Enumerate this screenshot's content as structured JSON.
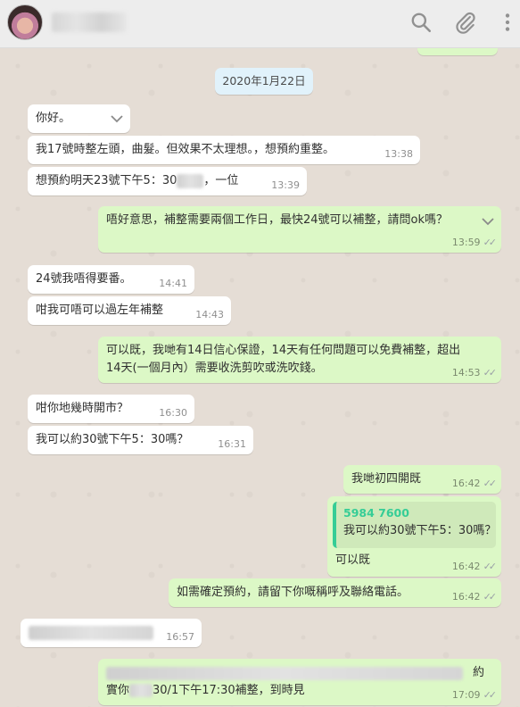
{
  "header": {
    "contact_name": "",
    "icons": [
      "search-icon",
      "paperclip-icon",
      "menu-icon"
    ]
  },
  "date_chip": "2020年1月22日",
  "messages": [
    {
      "dir": "in",
      "text": "你好。",
      "time": ""
    },
    {
      "dir": "in",
      "text": "我17號時整左頭，曲髮。但效果不太理想。，想預約重整。",
      "time": "13:38"
    },
    {
      "dir": "in",
      "text_before": "想預約明天23號下午5：30",
      "text_after": "，一位",
      "time": "13:39"
    },
    {
      "dir": "out",
      "text": "唔好意思，補整需要兩個工作日，最快24號可以補整，請問ok嗎？",
      "time": "13:59"
    },
    {
      "dir": "in",
      "text": "24號我唔得要番。",
      "time": "14:41"
    },
    {
      "dir": "in",
      "text": "咁我可唔可以過左年補整",
      "time": "14:43"
    },
    {
      "dir": "out",
      "line1": "可以既，我哋有14日信心保證，14天有任何問題可以免費補整，超出",
      "line2": "14天(一個月內）需要收洗剪吹或洗吹錢。",
      "time": "14:53"
    },
    {
      "dir": "in",
      "text": "咁你地幾時開市？",
      "time": "16:30"
    },
    {
      "dir": "in",
      "text": "我可以約30號下午5：30嗎？",
      "time": "16:31"
    },
    {
      "dir": "out",
      "text": "我哋初四開既",
      "time": "16:42"
    },
    {
      "dir": "out",
      "quote_name": "5984 7600",
      "quote_text": "我可以約30號下午5：30嗎？",
      "text": "可以既",
      "time": "16:42"
    },
    {
      "dir": "out",
      "text": "如需確定預約，請留下你嘅稱呼及聯絡電話。",
      "time": "16:42"
    },
    {
      "dir": "in",
      "text": "",
      "time": "16:57"
    },
    {
      "dir": "out",
      "line1_end": "約",
      "line2_start": "實你",
      "line2_rest": "30/1下午17:30補整，到時見",
      "time": "17:09"
    }
  ],
  "colors": {
    "chat_bg": "#e5ddd5",
    "incoming": "#ffffff",
    "outgoing": "#dcf8c6",
    "date_chip": "#e1f2fb",
    "quote_accent": "#35cd96"
  }
}
